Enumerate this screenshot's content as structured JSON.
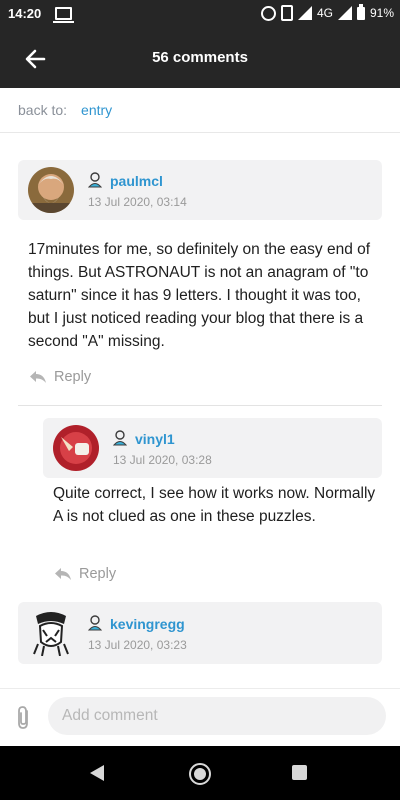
{
  "status_bar": {
    "time": "14:20",
    "network": "4G",
    "battery": "91%"
  },
  "app_bar": {
    "title": "56 comments",
    "back_icon": "arrow-left-icon"
  },
  "breadcrumb": {
    "label": "back to:",
    "link": "entry"
  },
  "comments": [
    {
      "username": "paulmcl",
      "timestamp": "13 Jul 2020, 03:14",
      "body": "17minutes for me, so definitely on the easy end of things. But ASTRONAUT is not an anagram of \"to saturn\" since it has 9 letters. I thought it was too, but I just noticed reading your blog that there is a second \"A\" missing.",
      "reply_label": "Reply"
    },
    {
      "username": "vinyl1",
      "timestamp": "13 Jul 2020, 03:28",
      "body": "Quite correct, I see how it works now. Normally A is not clued as one in these puzzles.",
      "reply_label": "Reply"
    },
    {
      "username": "kevingregg",
      "timestamp": "13 Jul 2020, 03:23"
    }
  ],
  "composer": {
    "placeholder": "Add comment",
    "attach_icon": "paperclip-icon"
  },
  "colors": {
    "bar": "#262626",
    "link": "#2f95d0",
    "header_bg": "#f2f2f3",
    "muted": "#9a9a9a"
  }
}
